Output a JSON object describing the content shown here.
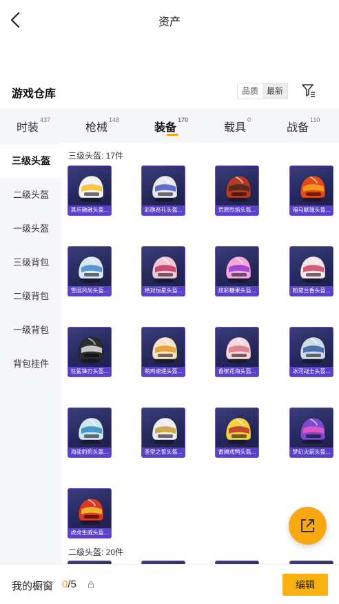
{
  "nav": {
    "title": "资产",
    "back_icon": "chevron-left-icon"
  },
  "warehouse": {
    "title": "游戏仓库",
    "sort_options": [
      "品质",
      "最新"
    ],
    "sort_selected": "最新",
    "filter_icon": "filter-icon"
  },
  "tabs": [
    {
      "label": "时装",
      "count": "437",
      "active": false
    },
    {
      "label": "枪械",
      "count": "148",
      "active": false
    },
    {
      "label": "装备",
      "count": "170",
      "active": true
    },
    {
      "label": "载具",
      "count": "0",
      "active": false
    },
    {
      "label": "战备",
      "count": "110",
      "active": false
    }
  ],
  "sidebar": {
    "items": [
      {
        "label": "三级头盔",
        "active": true
      },
      {
        "label": "二级头盔",
        "active": false
      },
      {
        "label": "一级头盔",
        "active": false
      },
      {
        "label": "三级背包",
        "active": false
      },
      {
        "label": "二级背包",
        "active": false
      },
      {
        "label": "一级背包",
        "active": false
      },
      {
        "label": "背包挂件",
        "active": false
      }
    ]
  },
  "sections": [
    {
      "label": "三级头盔: 17件",
      "items": [
        {
          "name": "其乐融融头盔...",
          "color": "#f2f2f2",
          "accent": "#f5c22a"
        },
        {
          "name": "彩旗巡礼头盔...",
          "color": "#e8e8f0",
          "accent": "#4a5fc8"
        },
        {
          "name": "荒原烈焰头盔...",
          "color": "#b23a25",
          "accent": "#4d2a1c"
        },
        {
          "name": "福马献瑞头盔...",
          "color": "#e04a1c",
          "accent": "#f6a21c"
        },
        {
          "name": "雪国风尚头盔...",
          "color": "#d7e9f4",
          "accent": "#4a8fd1"
        },
        {
          "name": "绝对恒星头盔...",
          "color": "#f1c7d6",
          "accent": "#c23b6a"
        },
        {
          "name": "炫彩糖果头盔...",
          "color": "#f3a6da",
          "accent": "#9b3fd1"
        },
        {
          "name": "粉黛兰香头盔...",
          "color": "#f6e6ec",
          "accent": "#d14b6a"
        },
        {
          "name": "狂鲨锋刃头盔...",
          "color": "#2d2d2d",
          "accent": "#d9d9d9"
        },
        {
          "name": "萌鸡速递头盔...",
          "color": "#f6e4c8",
          "accent": "#e89b2b"
        },
        {
          "name": "香槟花海头盔...",
          "color": "#f7d6dc",
          "accent": "#d97a8a"
        },
        {
          "name": "冰河战士头盔...",
          "color": "#cfdce8",
          "accent": "#3a66a8"
        },
        {
          "name": "海盐豹豹头盔...",
          "color": "#cde6f2",
          "accent": "#3a8fc2"
        },
        {
          "name": "圣堂之誓头盔...",
          "color": "#eeeef2",
          "accent": "#c9a23a"
        },
        {
          "name": "番摊戏鸭头盔...",
          "color": "#f5d040",
          "accent": "#c23a2a"
        },
        {
          "name": "梦幻火箭头盔...",
          "color": "#7a4ad1",
          "accent": "#e85ac2"
        },
        {
          "name": "虎虎生威头盔...",
          "color": "#d33a2a",
          "accent": "#f5c22a"
        }
      ]
    },
    {
      "label": "二级头盔: 20件"
    }
  ],
  "bottom_bar": {
    "label": "我的橱窗",
    "count_current": "0",
    "count_total": "/5",
    "lock_icon": "lock-icon",
    "edit_label": "编辑"
  },
  "fab": {
    "icon": "share-external-icon"
  },
  "colors": {
    "accent": "#f9b10f",
    "card_bg": "#24275a",
    "card_label": "#5b40c8",
    "sidebar_bg": "#f6f7fb"
  }
}
